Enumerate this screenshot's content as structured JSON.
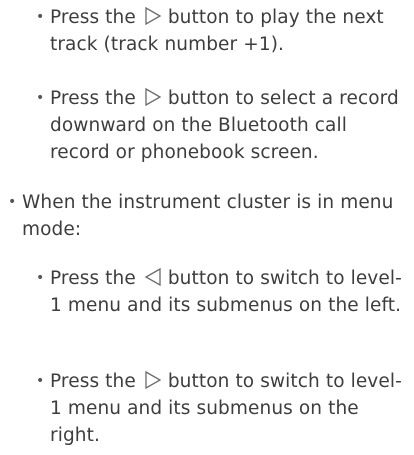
{
  "items": [
    {
      "level": 2,
      "pre": "Press the",
      "icon": "right-triangle-icon",
      "post": "button to play the next track (track number +1)."
    },
    {
      "level": 2,
      "pre": "Press the",
      "icon": "right-triangle-icon",
      "post": "button to select a record downward on the Bluetooth call record or phonebook screen."
    },
    {
      "level": 1,
      "text": "When the instrument cluster is in menu mode:"
    },
    {
      "level": 2,
      "pre": "Press the",
      "icon": "left-triangle-icon",
      "post": "button to switch to level-1 menu and its submenus on the left."
    },
    {
      "level": 2,
      "pre": "Press the",
      "icon": "right-triangle-icon",
      "post": "button to switch to level-1 menu and its submenus on the right."
    }
  ],
  "bullet_char": "•",
  "colors": {
    "text": "#3d3d3d",
    "icon_stroke": "#6b6b6b"
  }
}
